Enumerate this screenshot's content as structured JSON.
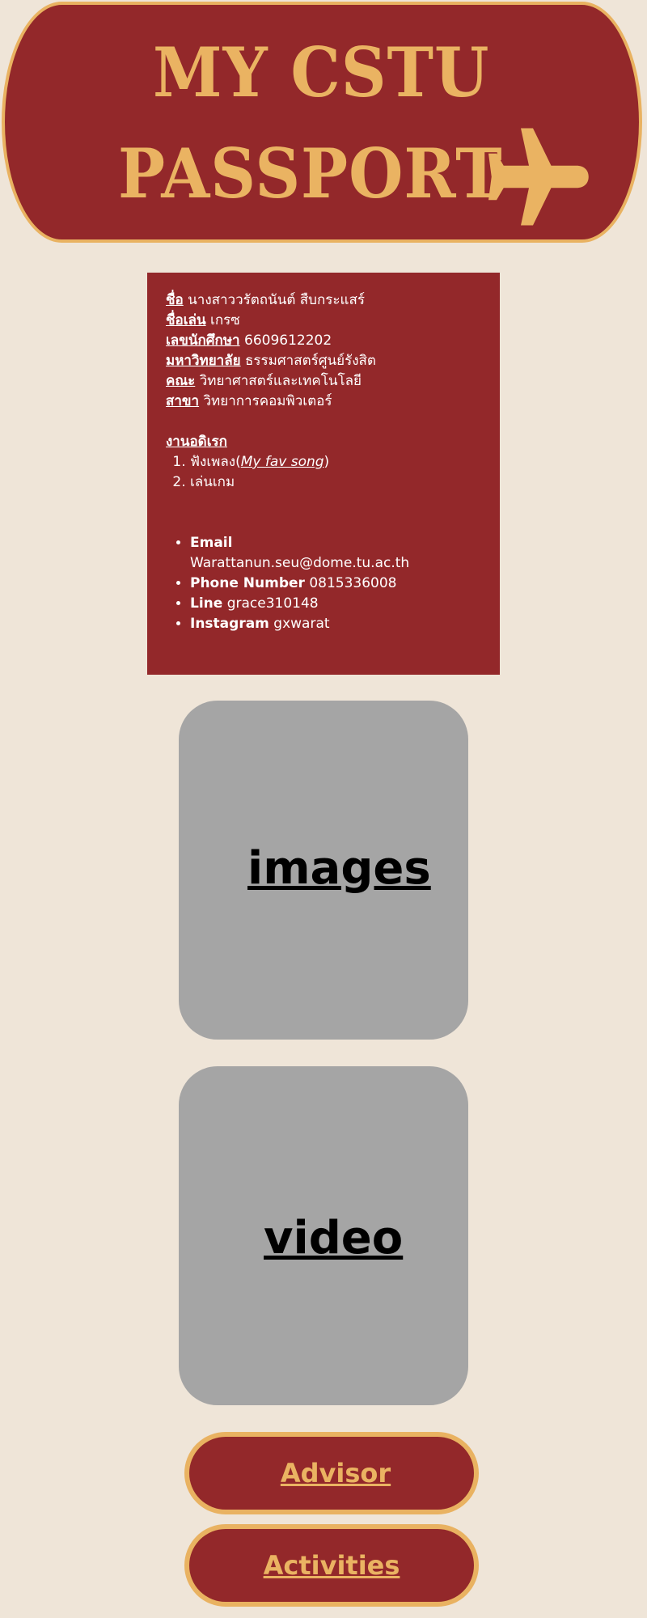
{
  "header": {
    "title_line1": "MY CSTU",
    "title_line2": "PASSPORT",
    "icon": "airplane-icon",
    "background_color": "#93282a",
    "accent_color": "#eab362"
  },
  "profile": {
    "name_label": "ชื่อ",
    "name_value": "นางสาววรัตถนันต์ สืบกระแสร์",
    "nickname_label": "ชื่อเล่น",
    "nickname_value": "เกรซ",
    "student_id_label": "เลขนักศึกษา",
    "student_id_value": "6609612202",
    "university_label": "มหาวิทยาลัย",
    "university_value": "ธรรมศาสตร์ศูนย์รังสิต",
    "faculty_label": "คณะ",
    "faculty_value": "วิทยาศาสตร์และเทคโนโลยี",
    "major_label": "สาขา",
    "major_value": "วิทยาการคอมพิวเตอร์"
  },
  "hobbies": {
    "title": "งานอดิเรก",
    "item1_text": "ฟังเพลง(",
    "item1_link": "My fav song",
    "item1_suffix": ")",
    "item2_text": "เล่นเกม"
  },
  "contacts": {
    "email_label": "Email",
    "email_value": "Warattanun.seu@dome.tu.ac.th",
    "phone_label": "Phone Number",
    "phone_value": "0815336008",
    "line_label": "Line",
    "line_value": "grace310148",
    "instagram_label": "Instagram",
    "instagram_value": "gxwarat"
  },
  "media": {
    "images_label": "images",
    "video_label": "video"
  },
  "buttons": {
    "advisor_label": "Advisor",
    "activities_label": "Activities"
  }
}
